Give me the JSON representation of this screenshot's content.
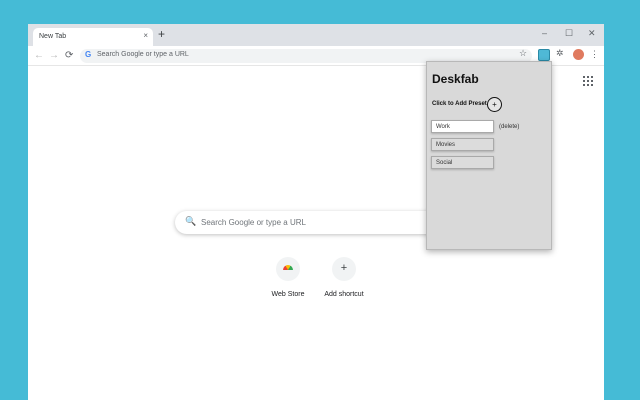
{
  "tab": {
    "title": "New Tab",
    "close": "×",
    "new_tab": "+"
  },
  "window_controls": {
    "minimize": "–",
    "maximize": "☐",
    "close": "✕"
  },
  "toolbar": {
    "back": "←",
    "forward": "→",
    "reload": "⟳",
    "omnibox_logo": "G",
    "omnibox_placeholder": "Search Google or type a URL",
    "star": "☆",
    "puzzle": "✲",
    "menu": "⋮"
  },
  "ntp": {
    "search_icon": "🔍",
    "search_placeholder": "Search Google or type a URL",
    "shortcuts": [
      {
        "label": "Web Store",
        "glyph": ""
      },
      {
        "label": "Add shortcut",
        "glyph": "+"
      }
    ]
  },
  "popup": {
    "title": "Deskfab",
    "add_preset_label": "Click to Add Preset",
    "add_button": "+",
    "presets": [
      {
        "label": "Work"
      },
      {
        "label": "Movies"
      },
      {
        "label": "Social"
      }
    ],
    "delete_label": "(delete)"
  },
  "colors": {
    "background": "#45bbd6",
    "tabstrip": "#dee1e6",
    "popup": "#d9d9d9",
    "extension_icon": "#4fb9d6"
  }
}
